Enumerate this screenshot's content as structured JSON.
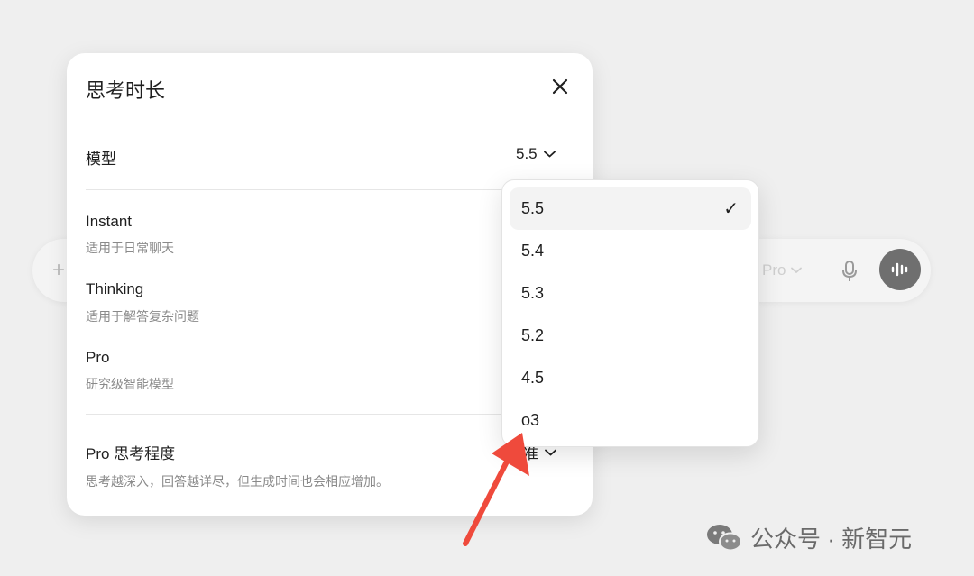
{
  "composer": {
    "plus": "+",
    "model_label": "Pro"
  },
  "dialog": {
    "title": "思考时长",
    "model_row": {
      "label": "模型",
      "selected": "5.5"
    },
    "options": [
      {
        "name": "Instant",
        "desc": "适用于日常聊天"
      },
      {
        "name": "Thinking",
        "desc": "适用于解答复杂问题"
      },
      {
        "name": "Pro",
        "desc": "研究级智能模型"
      }
    ],
    "pro_effort": {
      "label": "Pro 思考程度",
      "value": "准",
      "description": "思考越深入，回答越详尽，但生成时间也会相应增加。"
    }
  },
  "dropdown": {
    "items": [
      "5.5",
      "5.4",
      "5.3",
      "5.2",
      "4.5",
      "o3"
    ],
    "selected_index": 0,
    "check": "✓"
  },
  "watermark": {
    "text": "公众号 · 新智元"
  },
  "colors": {
    "arrow": "#ef4a3c",
    "background": "#efefef"
  }
}
